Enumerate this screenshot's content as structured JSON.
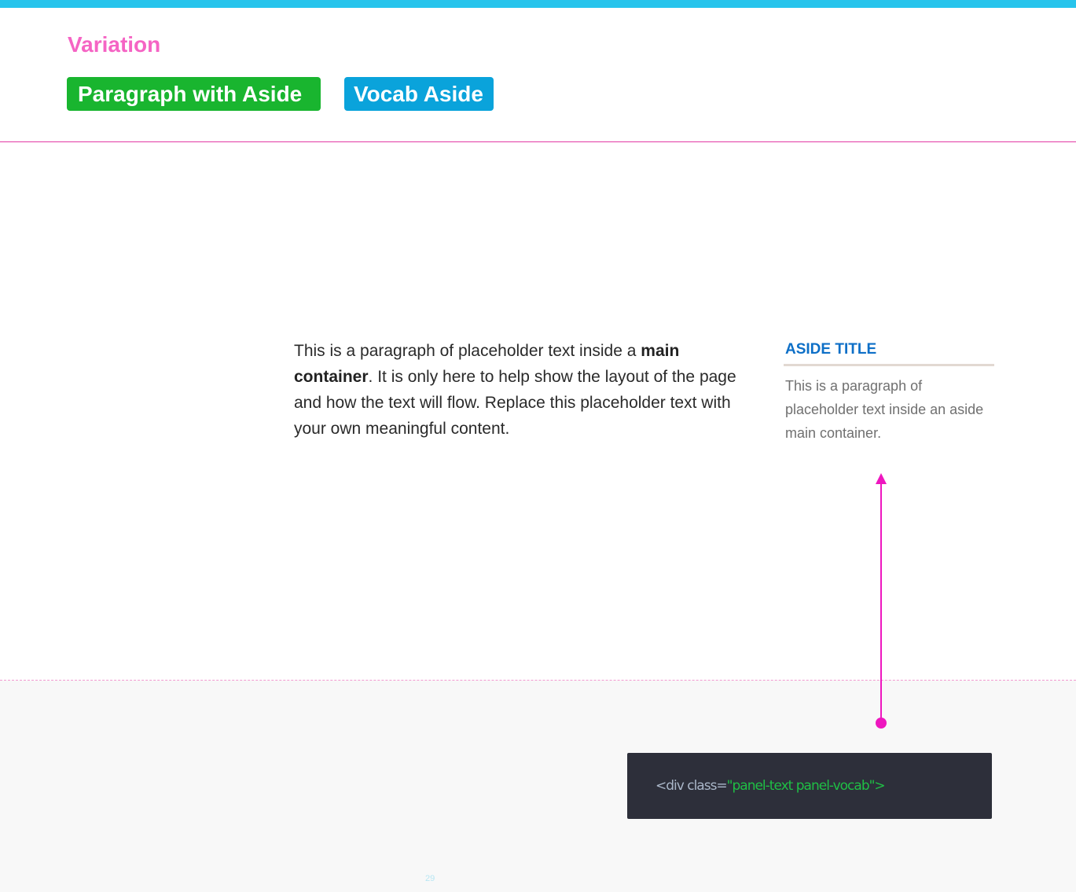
{
  "header": {
    "variation_label": "Variation",
    "tags": [
      {
        "label": "Paragraph with Aside"
      },
      {
        "label": "Vocab Aside"
      }
    ]
  },
  "main": {
    "paragraph_before": "This is a paragraph of placeholder text inside a ",
    "paragraph_bold": "main container",
    "paragraph_after": ". It is only here to help show the layout of the page and how the text will flow. Replace this placeholder text with your own meaningful content."
  },
  "aside": {
    "title": "ASIDE TITLE",
    "body": "This is a paragraph of placeholder text inside an aside main container."
  },
  "code": {
    "tag_open": "<div class=",
    "class_value": "\"panel-text panel-vocab\">"
  },
  "footer": {
    "page_number": "29"
  },
  "colors": {
    "accent_cyan": "#27c4ec",
    "accent_pink": "#f564c4",
    "tag_green": "#19b52f",
    "tag_blue": "#0aa3db",
    "divider_magenta": "#e23aa5",
    "aside_title": "#0d6fc7",
    "arrow_magenta": "#ee17bf"
  }
}
